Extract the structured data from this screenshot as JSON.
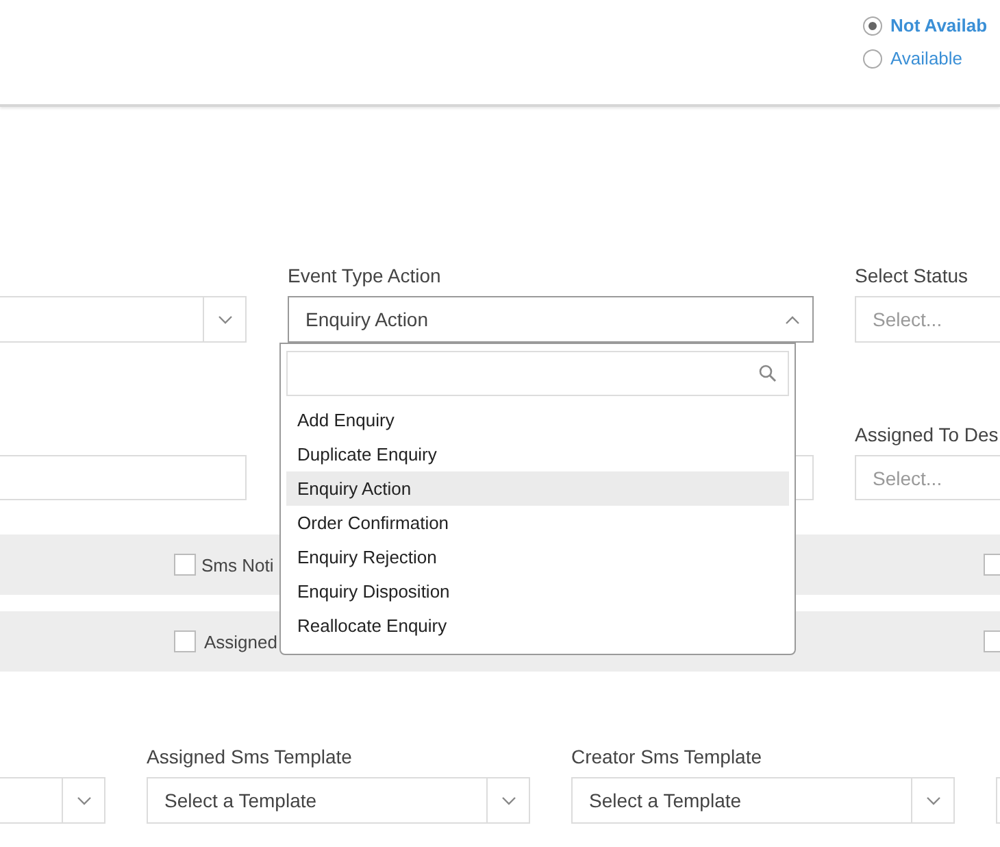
{
  "availability": {
    "options": [
      {
        "label": "Not Availab",
        "selected": true
      },
      {
        "label": "Available",
        "selected": false
      }
    ]
  },
  "row_1": [
    {
      "kind": "select"
    },
    {
      "kind": "select",
      "label": "Event Type Action",
      "value": "Enquiry Action",
      "open": true
    },
    {
      "kind": "select",
      "label": "Select Status",
      "placeholder": "Select..."
    }
  ],
  "row_2": [
    {
      "kind": "input"
    },
    {
      "kind": "input"
    },
    {
      "kind": "select",
      "label": "Assigned To Des",
      "placeholder": "Select..."
    }
  ],
  "event_type_dropdown": {
    "options": [
      {
        "label": "Add Enquiry",
        "selected": false
      },
      {
        "label": "Duplicate Enquiry",
        "selected": false
      },
      {
        "label": "Enquiry Action",
        "selected": true
      },
      {
        "label": "Order Confirmation",
        "selected": false
      },
      {
        "label": "Enquiry Rejection",
        "selected": false
      },
      {
        "label": "Enquiry Disposition",
        "selected": false
      },
      {
        "label": "Reallocate Enquiry",
        "selected": false
      }
    ]
  },
  "notification_rows": [
    {
      "checkboxes": [
        {
          "label": "Sms Noti",
          "checked": false
        },
        {
          "checked": false
        }
      ]
    },
    {
      "checkboxes": [
        {
          "label": "Assigned",
          "checked": false
        },
        {
          "checked": false
        }
      ]
    }
  ],
  "row_3": [
    {
      "kind": "select"
    },
    {
      "kind": "select",
      "label": "Assigned Sms Template",
      "value": "Select a Template"
    },
    {
      "kind": "select",
      "label": "Creator Sms Template",
      "value": "Select a Template"
    },
    {
      "kind": "select"
    }
  ]
}
